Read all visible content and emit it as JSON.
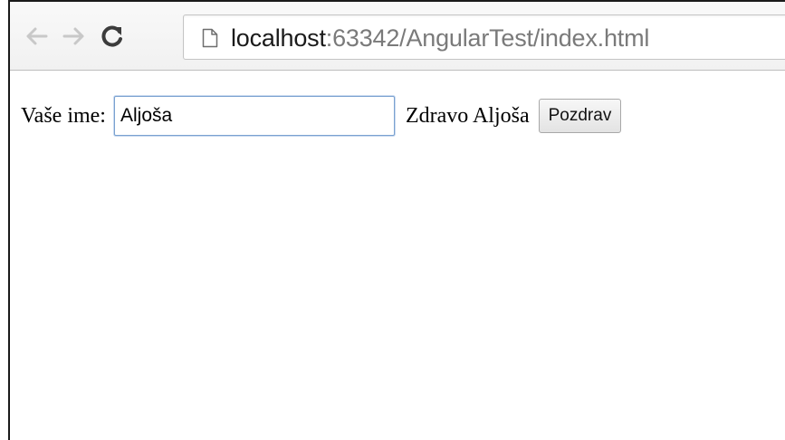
{
  "browser": {
    "icons": {
      "back": "arrow-left-icon",
      "forward": "arrow-right-icon",
      "reload": "reload-icon",
      "page": "page-icon"
    },
    "url": {
      "host": "localhost",
      "rest": ":63342/AngularTest/index.html"
    }
  },
  "page": {
    "label": "Vaše ime:",
    "input_value": "Aljoša",
    "greeting": "Zdravo Aljoša",
    "button_label": "Pozdrav"
  },
  "colors": {
    "input_focus_border": "#7aa1d0",
    "url_host": "#1a1a1a",
    "url_path": "#7a7a7a"
  }
}
